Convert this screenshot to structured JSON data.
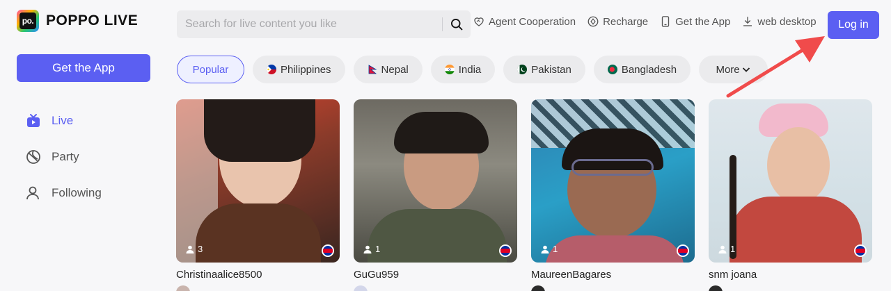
{
  "brand": {
    "logo_mark": "po.",
    "name": "POPPO LIVE"
  },
  "sidebar": {
    "get_app_label": "Get the App",
    "items": [
      {
        "label": "Live",
        "icon": "tv-icon",
        "active": true
      },
      {
        "label": "Party",
        "icon": "party-icon",
        "active": false
      },
      {
        "label": "Following",
        "icon": "user-icon",
        "active": false
      }
    ]
  },
  "search": {
    "placeholder": "Search for live content you like"
  },
  "top_links": [
    {
      "label": "Agent Cooperation",
      "icon": "heart-handshake-icon"
    },
    {
      "label": "Recharge",
      "icon": "coin-icon"
    },
    {
      "label": "Get the App",
      "icon": "phone-icon"
    },
    {
      "label": "web desktop",
      "icon": "download-icon"
    }
  ],
  "login_label": "Log in",
  "filters": [
    {
      "label": "Popular",
      "active": true
    },
    {
      "label": "Philippines",
      "flag": "philippines"
    },
    {
      "label": "Nepal",
      "flag": "nepal"
    },
    {
      "label": "India",
      "flag": "india"
    },
    {
      "label": "Pakistan",
      "flag": "pakistan"
    },
    {
      "label": "Bangladesh",
      "flag": "bangladesh"
    },
    {
      "label": "More",
      "dropdown": true
    }
  ],
  "cards": [
    {
      "name": "Christinaalice8500",
      "viewers": "3",
      "country": "cambodia"
    },
    {
      "name": "GuGu959",
      "viewers": "1",
      "country": "cambodia"
    },
    {
      "name": "MaureenBagares",
      "viewers": "1",
      "country": "cambodia"
    },
    {
      "name": "snm joana",
      "viewers": "1",
      "country": "cambodia"
    }
  ],
  "colors": {
    "accent": "#5b5ff2",
    "annotation_arrow": "#f04b4b"
  }
}
